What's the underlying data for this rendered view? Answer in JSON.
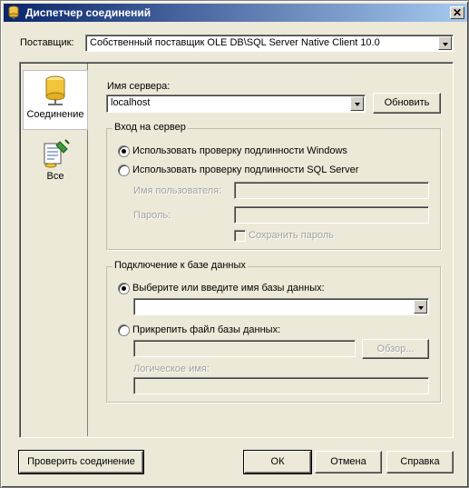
{
  "window": {
    "title": "Диспетчер соединений",
    "close_glyph": "✕"
  },
  "provider": {
    "label": "Поставщик:",
    "value": "Собственный поставщик OLE DB\\SQL Server Native Client 10.0"
  },
  "sidebar": {
    "items": [
      {
        "label": "Соединение",
        "icon": "database-cylinder-icon",
        "selected": true
      },
      {
        "label": "Все",
        "icon": "properties-list-icon",
        "selected": false
      }
    ]
  },
  "server": {
    "label": "Имя сервера:",
    "value": "localhost",
    "refresh_label": "Обновить"
  },
  "login": {
    "group_title": "Вход на сервер",
    "windows_auth_label": "Использовать проверку подлинности Windows",
    "sql_auth_label": "Использовать проверку подлинности SQL Server",
    "selected": "windows",
    "username_label": "Имя пользователя:",
    "password_label": "Пароль:",
    "save_password_label": "Сохранить пароль"
  },
  "database": {
    "group_title": "Подключение к базе данных",
    "select_db_label": "Выберите или введите имя базы данных:",
    "select_db_value": "",
    "attach_file_label": "Прикрепить файл базы данных:",
    "browse_label": "Обзор...",
    "logical_name_label": "Логическое имя:",
    "selected": "select"
  },
  "footer": {
    "test_connection_label": "Проверить соединение",
    "ok_label": "ОК",
    "cancel_label": "Отмена",
    "help_label": "Справка"
  },
  "colors": {
    "titlebar_start": "#0a246a",
    "titlebar_end": "#a6caf0",
    "window_bg": "#ece9d8"
  }
}
